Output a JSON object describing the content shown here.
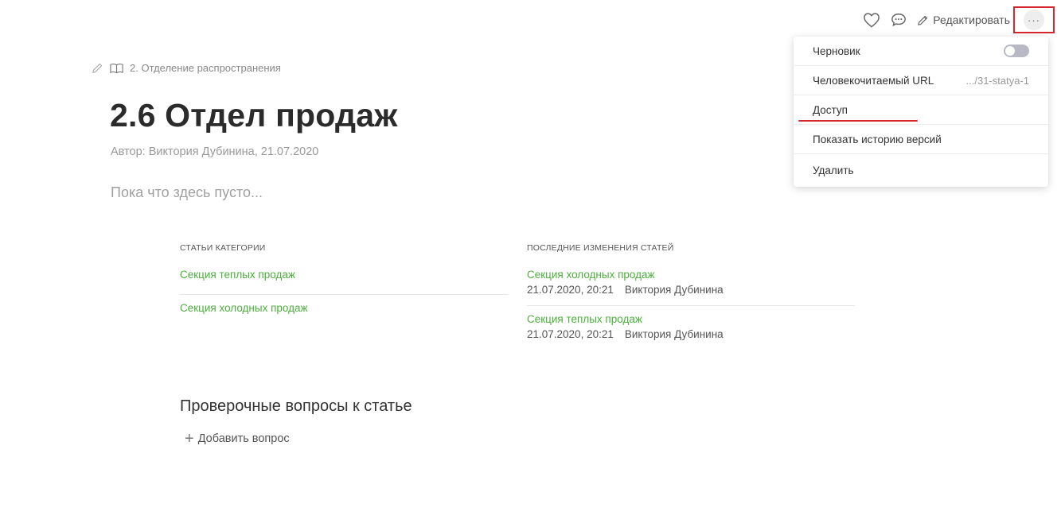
{
  "toolbar": {
    "like_icon": "heart-icon",
    "comment_icon": "comment-icon",
    "edit_label": "Редактировать",
    "more_label": "···"
  },
  "dropdown": {
    "draft_label": "Черновик",
    "draft_enabled": false,
    "url_label": "Человекочитаемый URL",
    "url_value": ".../31-statya-1",
    "access_label": "Доступ",
    "history_label": "Показать историю версий",
    "delete_label": "Удалить"
  },
  "breadcrumb": {
    "section": "2. Отделение распространения"
  },
  "article": {
    "title": "2.6 Отдел продаж",
    "author": "Автор: Виктория Дубинина, 21.07.2020",
    "empty": "Пока что здесь пусто..."
  },
  "categories": {
    "header": "Статьи категории",
    "items": [
      "Секция теплых продаж",
      "Секция холодных продаж"
    ]
  },
  "changes": {
    "header": "Последние изменения статей",
    "items": [
      {
        "title": "Секция холодных продаж",
        "date": "21.07.2020, 20:21",
        "author": "Виктория Дубинина"
      },
      {
        "title": "Секция теплых продаж",
        "date": "21.07.2020, 20:21",
        "author": "Виктория Дубинина"
      }
    ]
  },
  "questions": {
    "title": "Проверочные вопросы к статье",
    "add_label": "Добавить вопрос"
  },
  "colors": {
    "link": "#4caf3c",
    "highlight": "#d7262e"
  }
}
